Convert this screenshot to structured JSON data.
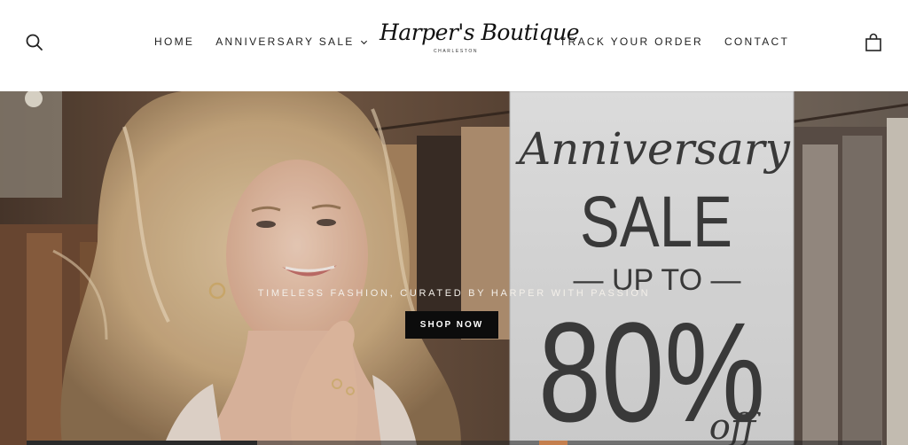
{
  "header": {
    "nav_left": [
      {
        "label": "HOME"
      },
      {
        "label": "ANNIVERSARY SALE",
        "has_dropdown": true
      }
    ],
    "nav_right": [
      {
        "label": "TRACK YOUR ORDER"
      },
      {
        "label": "CONTACT"
      }
    ],
    "logo": {
      "script": "Harper's Boutique",
      "sub": "CHARLESTON"
    },
    "icons": {
      "search": "search-icon",
      "cart": "shopping-bag-icon",
      "dropdown": "chevron-down-icon"
    }
  },
  "hero": {
    "tagline": "TIMELESS FASHION, CURATED BY HARPER WITH PASSION",
    "cta_label": "SHOP NOW",
    "sign": {
      "line1": "Anniversary",
      "line2": "SALE",
      "line3": "— UP TO —",
      "line4": "80%",
      "line5": "off"
    },
    "slideshow_progress": 0.27
  },
  "colors": {
    "header_bg": "#ffffff",
    "nav_text": "#222222",
    "button_bg": "#0c0c0c",
    "button_text": "#ffffff",
    "tagline_text": "#f3efe9",
    "progress_accent": "#c47f4d"
  }
}
